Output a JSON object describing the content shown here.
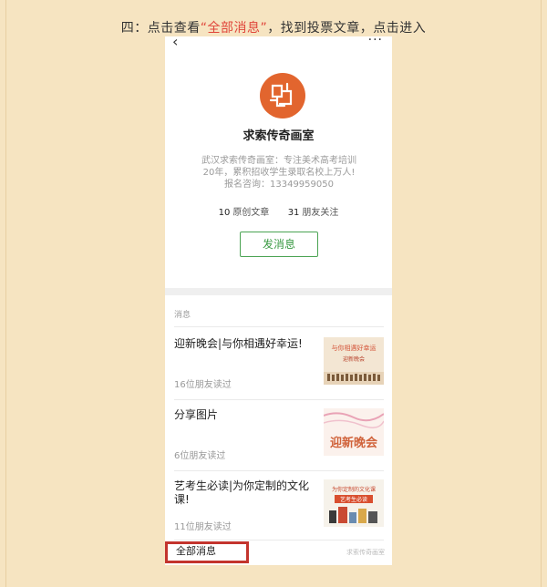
{
  "instruction": {
    "prefix": "四：点击查看",
    "highlight": "“全部消息”",
    "suffix": "，找到投票文章，点击进入"
  },
  "topbar": {
    "back_icon": "‹",
    "more_icon": "···"
  },
  "account": {
    "name": "求索传奇画室",
    "desc_lines": [
      "武汉求索传奇画室：专注美术高考培训",
      "20年，累积招收学生录取名校上万人!",
      "报名咨询：13349959050"
    ],
    "original_count": "10",
    "original_label": "原创文章",
    "friends_count": "31",
    "friends_label": "朋友关注",
    "message_button": "发消息",
    "logo_color": "#e2652e"
  },
  "messages": {
    "section_label": "消息",
    "items": [
      {
        "title": "迎新晚会|与你相遇好幸运!",
        "reads": "16位朋友读过"
      },
      {
        "title": "分享图片",
        "reads": "6位朋友读过"
      },
      {
        "title": "艺考生必读|为你定制的文化课!",
        "reads": "11位朋友读过"
      }
    ],
    "thumb_texts": [
      "与你相遇好幸运",
      "迎新晚会",
      "迎新晚会",
      "为你定制的文化课",
      "艺考生必读"
    ]
  },
  "footer": {
    "all_messages": "全部消息",
    "watermark": "求索传奇画室",
    "highlight_color": "#c3342d"
  }
}
